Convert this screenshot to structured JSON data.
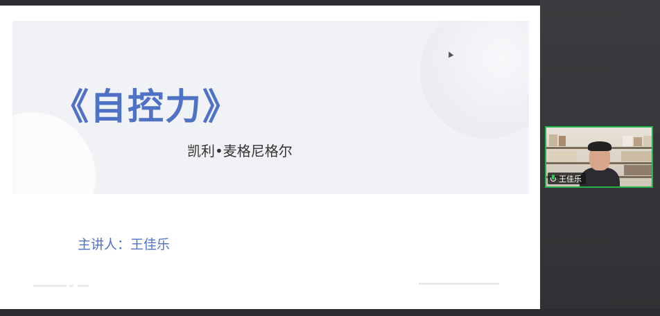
{
  "slide": {
    "title": "《自控力》",
    "author": "凯利•麦格尼格尔",
    "presenter": "主讲人：王佳乐"
  },
  "participant": {
    "name": "王佳乐",
    "mic_status": "on",
    "speaking_highlight_color": "#24b24b"
  },
  "colors": {
    "accent": "#4f72c7",
    "banner": "#f1f2f5",
    "background": "#2b2d30"
  }
}
